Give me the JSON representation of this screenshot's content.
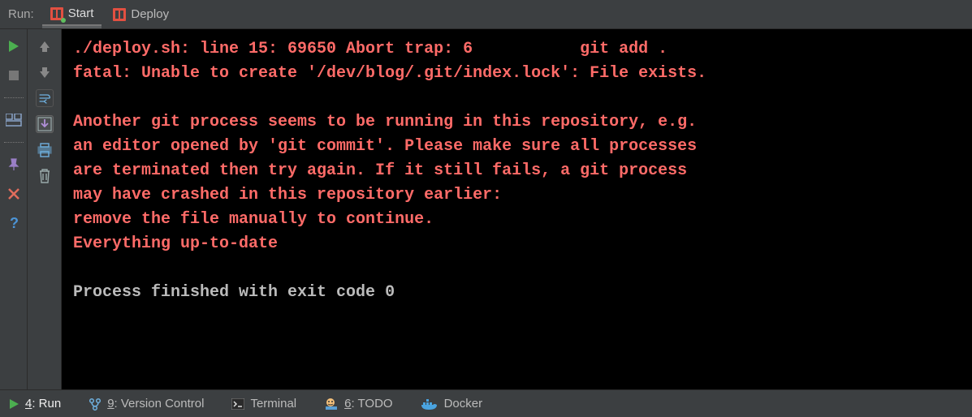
{
  "top": {
    "label": "Run:",
    "tabs": [
      {
        "label": "Start",
        "active": true
      },
      {
        "label": "Deploy",
        "active": false
      }
    ]
  },
  "console": {
    "error_lines": [
      "./deploy.sh: line 15: 69650 Abort trap: 6           git add .",
      "fatal: Unable to create '/dev/blog/.git/index.lock': File exists.",
      "",
      "Another git process seems to be running in this repository, e.g.",
      "an editor opened by 'git commit'. Please make sure all processes",
      "are terminated then try again. If it still fails, a git process",
      "may have crashed in this repository earlier:",
      "remove the file manually to continue.",
      "Everything up-to-date"
    ],
    "status_line": "Process finished with exit code 0"
  },
  "bottom": {
    "items": [
      {
        "mnemonic": "4",
        "label": ": Run"
      },
      {
        "mnemonic": "9",
        "label": ": Version Control"
      },
      {
        "mnemonic": "",
        "label": "Terminal"
      },
      {
        "mnemonic": "6",
        "label": ": TODO"
      },
      {
        "mnemonic": "",
        "label": "Docker"
      }
    ]
  }
}
